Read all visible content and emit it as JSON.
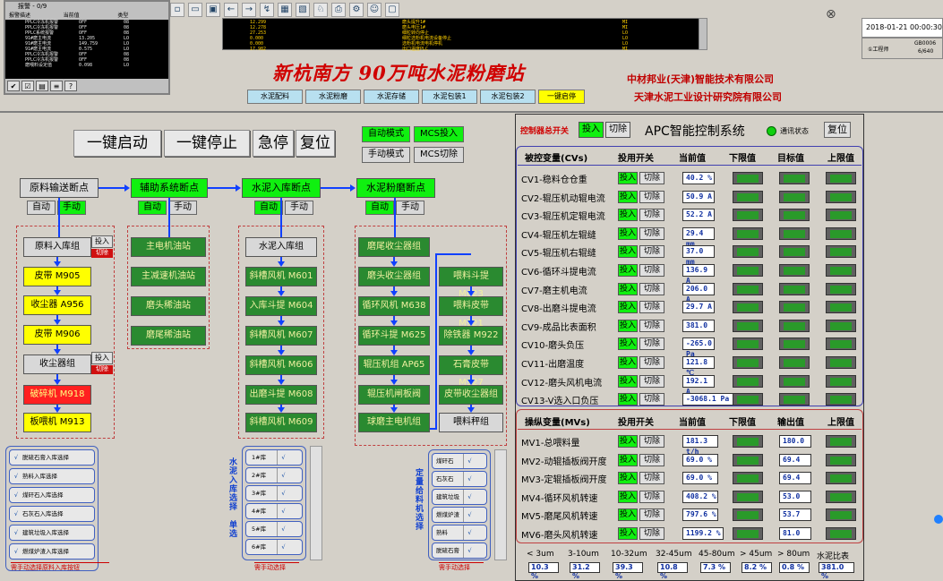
{
  "alarm_window": {
    "title": "报警 - 0/9",
    "headers": [
      "报警描述",
      "当前值",
      "类型"
    ],
    "rows": [
      [
        "PPLC冷冻机报警",
        "OFF",
        "08"
      ],
      [
        "PPLC冷冻机报警",
        "OFF",
        "08"
      ],
      [
        "PPLC系统报警",
        "OFF",
        "08"
      ],
      [
        "91#磨主电流",
        "13.205",
        "LO"
      ],
      [
        "91#磨主电流",
        "149.759",
        "LO"
      ],
      [
        "91#磨主电流",
        "0.575",
        "LO"
      ],
      [
        "PPLC冷冻机报警",
        "OFF",
        "08"
      ],
      [
        "PPLC冷冻机报警",
        "OFF",
        "08"
      ],
      [
        "磨喂料设定值",
        "0.098",
        "LO"
      ]
    ],
    "toolbar_icons": [
      "check-icon",
      "check-all-icon",
      "filter-icon",
      "list-icon",
      "help-icon"
    ]
  },
  "value_panel": {
    "col1": [
      "12.299",
      "12.278",
      "27.253",
      "0.000",
      "0.000",
      "17.982"
    ],
    "col2": [
      "磨头提升1#",
      "磨头电压1#",
      "细粒转向停止",
      "细粒选粉机电流设备停止",
      "选粉机电流电机停机",
      "出口温度PLC"
    ],
    "col3": [
      "MI",
      "MI",
      "LO",
      "LO",
      "LO",
      "MI"
    ]
  },
  "header": {
    "date": "2018-01-21 00:00:30",
    "info_left": "①工程师",
    "info_right_1": "GB0006",
    "info_right_2": "6/640",
    "title": "新杭南方 90万吨水泥粉磨站",
    "company1": "中材邦业(天津)智能技术有限公司",
    "company2": "天津水泥工业设计研究院有限公司",
    "tabs": [
      {
        "label": "水泥配料",
        "active": false
      },
      {
        "label": "水泥粉磨",
        "active": false
      },
      {
        "label": "水泥存储",
        "active": false
      },
      {
        "label": "水泥包装1",
        "active": false
      },
      {
        "label": "水泥包装2",
        "active": false
      },
      {
        "label": "一键启停",
        "active": true
      }
    ]
  },
  "controls": {
    "one_key_start": "一键启动",
    "one_key_stop": "一键停止",
    "emergency_stop": "急停",
    "reset": "复位",
    "auto_mode": "自动模式",
    "mcs_on": "MCS投入",
    "manual_mode": "手动模式",
    "mcs_off": "MCS切除"
  },
  "flow": {
    "bp1": "原料输送断点",
    "bp2": "辅助系统断点",
    "bp3": "水泥入库断点",
    "bp4": "水泥粉磨断点",
    "auto": "自动",
    "manual": "手动",
    "col1": [
      {
        "label": "原料入库组",
        "color": "gray"
      },
      {
        "label": "皮带 M905",
        "color": "yellow"
      },
      {
        "label": "收尘器 A956",
        "color": "yellow"
      },
      {
        "label": "皮带 M906",
        "color": "yellow"
      },
      {
        "label": "收尘器组",
        "color": "gray"
      },
      {
        "label": "破碎机 M918",
        "color": "red"
      },
      {
        "label": "板喂机 M913",
        "color": "yellow"
      }
    ],
    "col1_tou": "投入",
    "col1_qie": "切除",
    "col2": [
      "主电机油站",
      "主减速机油站",
      "磨头稀油站",
      "磨尾稀油站"
    ],
    "col3": [
      "水泥入库组",
      "斜槽风机 M601",
      "入库斗提 M604",
      "斜槽风机 M607",
      "斜槽风机 M606",
      "出磨斗提 M608",
      "斜槽风机 M609"
    ],
    "col4a": [
      "磨尾收尘器组",
      "磨头收尘器组",
      "循环风机 M638",
      "循环斗提 M625",
      "辊压机组 AP65",
      "辊压机闸板阀",
      "球磨主电机组"
    ],
    "col4b": [
      "喂料斗提 M623",
      "喂料皮带 M921",
      "除铁器 M922",
      "石膏皮带 M927",
      "皮带收尘器组",
      "喂料秤组"
    ]
  },
  "sel_left": {
    "rows": [
      "脱硫石膏入库选择",
      "熟料入库选择",
      "煤矸石入库选择",
      "石灰石入库选择",
      "建筑垃圾入库选择",
      "燃煤炉渣入库选择"
    ],
    "footer": "需手动选择原料入库按钮",
    "check": "√"
  },
  "sel_mid": {
    "vlabel": "水泥入库选择",
    "vlabel2": "单选",
    "rows": [
      "1#库",
      "2#库",
      "3#库",
      "4#库",
      "5#库",
      "6#库"
    ],
    "footer": "需手动选择",
    "check": "√"
  },
  "sel_right": {
    "vlabel": "定量给料机选择",
    "rows": [
      "煤矸石",
      "石灰石",
      "建筑垃圾",
      "燃煤炉渣",
      "熟料",
      "脱硫石膏"
    ],
    "footer": "需手动选择",
    "check": "√"
  },
  "apc": {
    "ctrl_switch": "控制器总开关",
    "tou": "投入",
    "qie": "切除",
    "system_title": "APC智能控制系统",
    "comm_status": "通讯状态",
    "reset": "复位",
    "cv_headers": [
      "被控变量(CVs)",
      "投用开关",
      "当前值",
      "下限值",
      "目标值",
      "上限值"
    ],
    "cvs": [
      {
        "name": "CV1-稳料仓仓重",
        "value": "40.2 %"
      },
      {
        "name": "CV2-辊压机动辊电流",
        "value": "50.9 A"
      },
      {
        "name": "CV3-辊压机定辊电流",
        "value": "52.2 A"
      },
      {
        "name": "CV4-辊压机左辊缝",
        "value": "29.4 mm"
      },
      {
        "name": "CV5-辊压机右辊缝",
        "value": "37.0 mm"
      },
      {
        "name": "CV6-循环斗提电流",
        "value": "136.9 A"
      },
      {
        "name": "CV7-磨主机电流",
        "value": "206.0 A"
      },
      {
        "name": "CV8-出磨斗提电流",
        "value": "29.7 A"
      },
      {
        "name": "CV9-成品比表面积",
        "value": "381.0"
      },
      {
        "name": "CV10-磨头负压",
        "value": "-265.0 Pa"
      },
      {
        "name": "CV11-出磨温度",
        "value": "121.8 ℃"
      },
      {
        "name": "CV12-磨头风机电流",
        "value": "192.1 A"
      },
      {
        "name": "CV13-V选入口负压",
        "value": "-3068.1 Pa"
      }
    ],
    "mv_headers": [
      "操纵变量(MVs)",
      "投用开关",
      "当前值",
      "下限值",
      "输出值",
      "上限值"
    ],
    "mvs": [
      {
        "name": "MV1-总喂料量",
        "value": "181.3 t/h",
        "output": "180.0"
      },
      {
        "name": "MV2-动辊插板阀开度",
        "value": "69.0 %",
        "output": "69.4"
      },
      {
        "name": "MV3-定辊插板阀开度",
        "value": "69.0 %",
        "output": "69.4"
      },
      {
        "name": "MV4-循环风机转速",
        "value": "408.2 %",
        "output": "53.0"
      },
      {
        "name": "MV5-磨尾风机转速",
        "value": "797.6 %",
        "output": "53.7"
      },
      {
        "name": "MV6-磨头风机转速",
        "value": "1199.2 %",
        "output": "81.0"
      }
    ],
    "psd_labels": [
      "< 3um",
      "3-10um",
      "10-32um",
      "32-45um",
      "45-80um",
      "> 45um",
      "> 80um",
      "水泥比表"
    ],
    "psd_values": [
      "10.3 %",
      "31.2 %",
      "39.3 %",
      "10.8 %",
      "7.3 %",
      "8.2 %",
      "0.8 %",
      "381.0 %"
    ]
  }
}
